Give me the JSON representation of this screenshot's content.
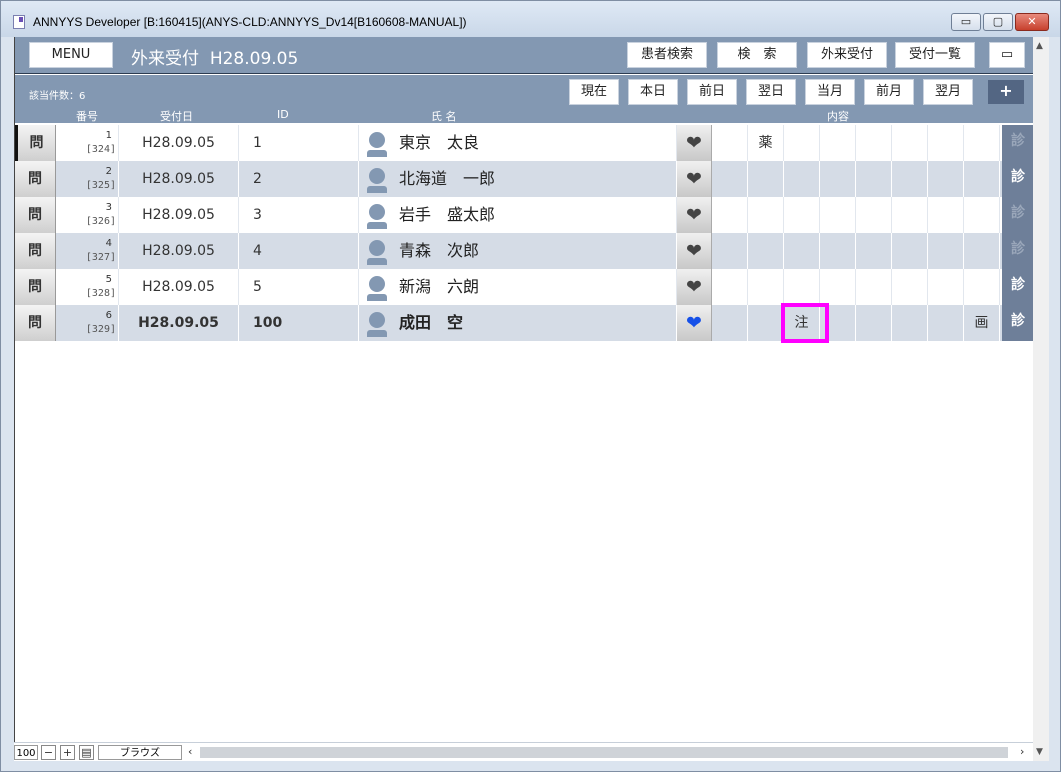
{
  "window": {
    "title": "ANNYYS Developer [B:160415](ANYS-CLD:ANNYYS_Dv14[B160608-MANUAL])",
    "min_label": "▭",
    "max_label": "▢",
    "close_label": "✕"
  },
  "header": {
    "menu_label": "MENU",
    "screen_title": "外来受付",
    "screen_date": "H28.09.05",
    "buttons": [
      "患者検索",
      "検　索",
      "外来受付",
      "受付一覧"
    ],
    "view_toggle_label": "▭"
  },
  "toolbar": {
    "count_label": "該当件数：6",
    "date_buttons": [
      "現在",
      "本日",
      "前日",
      "翌日",
      "当月",
      "前月",
      "翌月"
    ],
    "plus_label": "+"
  },
  "columns": {
    "number": "番号",
    "date": "受付日",
    "id": "ID",
    "name": "氏 名",
    "content": "内容"
  },
  "rows": [
    {
      "q": "問",
      "num": "1",
      "ref": "[324]",
      "date": "H28.09.05",
      "id": "1",
      "name": "東京　太良",
      "heart": "❤",
      "heart_color": "#444444",
      "contents": [
        "",
        "薬",
        "",
        "",
        "",
        "",
        "",
        ""
      ],
      "diag": "診",
      "diag_active": false
    },
    {
      "q": "問",
      "num": "2",
      "ref": "[325]",
      "date": "H28.09.05",
      "id": "2",
      "name": "北海道　一郎",
      "heart": "❤",
      "heart_color": "#444444",
      "contents": [
        "",
        "",
        "",
        "",
        "",
        "",
        "",
        ""
      ],
      "diag": "診",
      "diag_active": true
    },
    {
      "q": "問",
      "num": "3",
      "ref": "[326]",
      "date": "H28.09.05",
      "id": "3",
      "name": "岩手　盛太郎",
      "heart": "❤",
      "heart_color": "#444444",
      "contents": [
        "",
        "",
        "",
        "",
        "",
        "",
        "",
        ""
      ],
      "diag": "診",
      "diag_active": false
    },
    {
      "q": "問",
      "num": "4",
      "ref": "[327]",
      "date": "H28.09.05",
      "id": "4",
      "name": "青森　次郎",
      "heart": "❤",
      "heart_color": "#444444",
      "contents": [
        "",
        "",
        "",
        "",
        "",
        "",
        "",
        ""
      ],
      "diag": "診",
      "diag_active": false
    },
    {
      "q": "問",
      "num": "5",
      "ref": "[328]",
      "date": "H28.09.05",
      "id": "5",
      "name": "新潟　六朗",
      "heart": "❤",
      "heart_color": "#444444",
      "contents": [
        "",
        "",
        "",
        "",
        "",
        "",
        "",
        ""
      ],
      "diag": "診",
      "diag_active": true
    },
    {
      "q": "問",
      "num": "6",
      "ref": "[329]",
      "date": "H28.09.05",
      "id": "100",
      "name": "成田　空",
      "heart": "❤",
      "heart_color": "#1550e8",
      "contents": [
        "",
        "",
        "注",
        "",
        "",
        "",
        "",
        "画"
      ],
      "diag": "診",
      "diag_active": true
    }
  ],
  "statusbar": {
    "zoom": "100",
    "mode": "ブラウズ"
  },
  "colors": {
    "header_bg": "#8398b2",
    "row_shade": "#d5dce6",
    "highlight": "#ff00ff"
  }
}
